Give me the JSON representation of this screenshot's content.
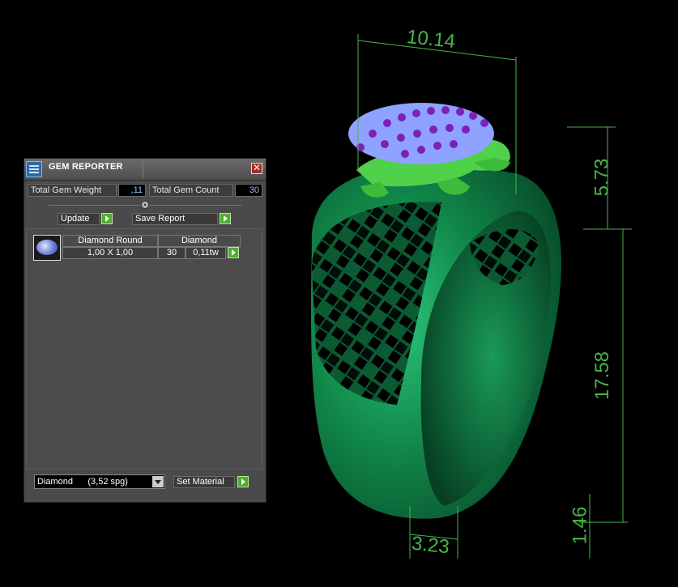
{
  "panel": {
    "title": "GEM REPORTER",
    "close_glyph": "✕",
    "total_weight_label": "Total Gem Weight",
    "total_weight_value": ",11",
    "total_count_label": "Total Gem Count",
    "total_count_value": "30",
    "update_label": "Update",
    "save_report_label": "Save Report",
    "table": {
      "columns": [
        "Diamond Round",
        "Diamond"
      ],
      "rows": [
        {
          "size": "1,00 X 1,00",
          "count": "30",
          "weight": "0,11tw"
        }
      ]
    },
    "material_select": "Diamond      (3,52 spg)",
    "set_material_label": "Set Material"
  },
  "dimensions": {
    "top_width": "10.14",
    "head_height": "5.73",
    "shank_height": "17.58",
    "bottom_thickness": "1.46",
    "band_width": "3.23"
  },
  "colors": {
    "dimension_green": "#47b547",
    "ring_green": "#0f6a3c",
    "frog_green": "#4fd14a",
    "gem_blue": "#8fa2ff",
    "gem_purple": "#7a22b8"
  }
}
